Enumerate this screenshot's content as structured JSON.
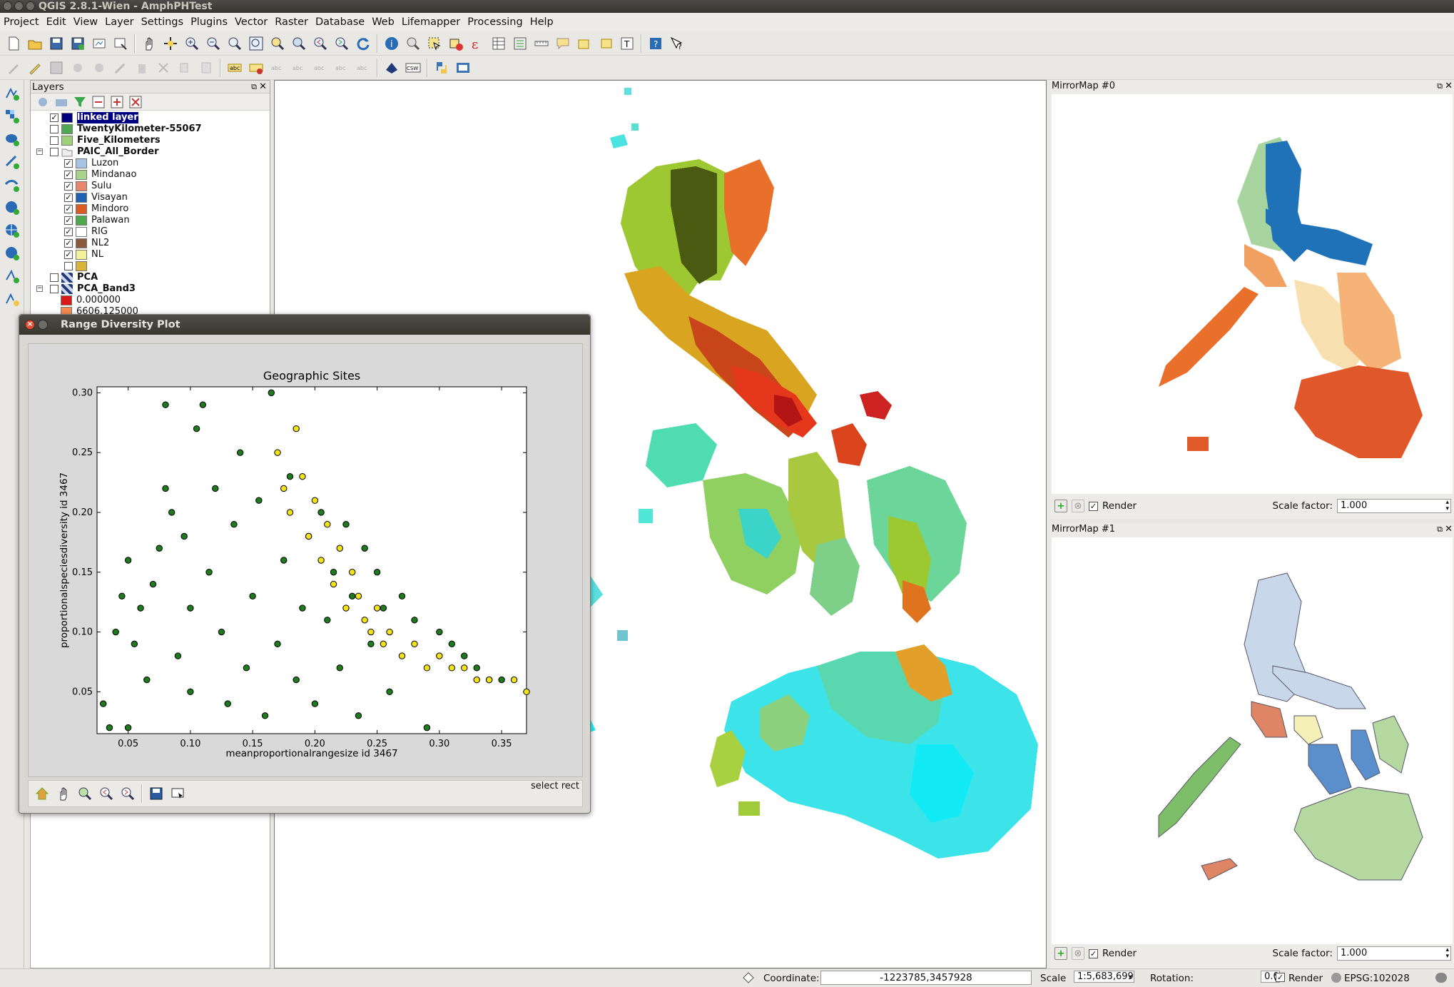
{
  "window": {
    "title": "QGIS 2.8.1-Wien - AmphPHTest"
  },
  "menu": [
    "Project",
    "Edit",
    "View",
    "Layer",
    "Settings",
    "Plugins",
    "Vector",
    "Raster",
    "Database",
    "Web",
    "Lifemapper",
    "Processing",
    "Help"
  ],
  "layers_panel": {
    "title": "Layers",
    "items": [
      {
        "label": "linked layer",
        "checked": true,
        "bold": true,
        "selected": true,
        "swatch": "#000080"
      },
      {
        "label": "TwentyKilometer-55067",
        "checked": false,
        "bold": true,
        "swatch": "#52a852"
      },
      {
        "label": "Five_Kilometers",
        "checked": false,
        "bold": true,
        "swatch": "#9fd07a"
      },
      {
        "label": "PAIC_All_Border",
        "checked": false,
        "bold": true,
        "group": true
      },
      {
        "label": "Luzon",
        "checked": true,
        "swatch": "#a6c4e4"
      },
      {
        "label": "Mindanao",
        "checked": true,
        "swatch": "#a7d38a"
      },
      {
        "label": "Sulu",
        "checked": true,
        "swatch": "#e8866a"
      },
      {
        "label": "Visayan",
        "checked": true,
        "swatch": "#1f62b4"
      },
      {
        "label": "Mindoro",
        "checked": true,
        "swatch": "#dd5a23"
      },
      {
        "label": "Palawan",
        "checked": true,
        "swatch": "#4fa84d"
      },
      {
        "label": "RIG",
        "checked": true,
        "swatch": "#ffffff"
      },
      {
        "label": "NL2",
        "checked": true,
        "swatch": "#8b5a3a"
      },
      {
        "label": "NL",
        "checked": true,
        "swatch": "#f4f19a"
      },
      {
        "label": "",
        "checked": false,
        "swatch": "#d9b43a"
      },
      {
        "label": "PCA",
        "checked": false,
        "bold": true,
        "raster": true
      },
      {
        "label": "PCA_Band3",
        "checked": false,
        "bold": true,
        "raster": true,
        "group": true
      },
      {
        "label": "0.000000",
        "swatch": "#d7191c"
      },
      {
        "label": "6606.125000",
        "swatch": "#f58d52"
      }
    ]
  },
  "dialog": {
    "title": "Range Diversity Plot",
    "status": "select rect"
  },
  "chart_data": {
    "type": "scatter",
    "title": "Geographic Sites",
    "xlabel": "meanproportionalrangesize id 3467",
    "ylabel": "proportionalspeciesdiversity id 3467",
    "xlim": [
      0.025,
      0.37
    ],
    "ylim": [
      0.015,
      0.305
    ],
    "xticks": [
      "0.05",
      "0.10",
      "0.15",
      "0.20",
      "0.25",
      "0.30",
      "0.35"
    ],
    "yticks": [
      "0.05",
      "0.10",
      "0.15",
      "0.20",
      "0.25",
      "0.30"
    ],
    "grid": false,
    "series": [
      {
        "color": "#1d7a1d",
        "values": [
          [
            0.03,
            0.04
          ],
          [
            0.035,
            0.02
          ],
          [
            0.05,
            0.02
          ],
          [
            0.04,
            0.1
          ],
          [
            0.045,
            0.13
          ],
          [
            0.05,
            0.16
          ],
          [
            0.055,
            0.09
          ],
          [
            0.06,
            0.12
          ],
          [
            0.065,
            0.06
          ],
          [
            0.07,
            0.14
          ],
          [
            0.075,
            0.17
          ],
          [
            0.08,
            0.29
          ],
          [
            0.08,
            0.22
          ],
          [
            0.085,
            0.2
          ],
          [
            0.09,
            0.08
          ],
          [
            0.095,
            0.18
          ],
          [
            0.1,
            0.12
          ],
          [
            0.1,
            0.05
          ],
          [
            0.105,
            0.27
          ],
          [
            0.11,
            0.29
          ],
          [
            0.115,
            0.15
          ],
          [
            0.12,
            0.22
          ],
          [
            0.125,
            0.1
          ],
          [
            0.13,
            0.04
          ],
          [
            0.135,
            0.19
          ],
          [
            0.14,
            0.25
          ],
          [
            0.145,
            0.07
          ],
          [
            0.15,
            0.13
          ],
          [
            0.155,
            0.21
          ],
          [
            0.16,
            0.03
          ],
          [
            0.165,
            0.3
          ],
          [
            0.17,
            0.09
          ],
          [
            0.175,
            0.16
          ],
          [
            0.18,
            0.23
          ],
          [
            0.185,
            0.06
          ],
          [
            0.19,
            0.12
          ],
          [
            0.195,
            0.18
          ],
          [
            0.2,
            0.04
          ],
          [
            0.205,
            0.2
          ],
          [
            0.21,
            0.11
          ],
          [
            0.215,
            0.15
          ],
          [
            0.22,
            0.07
          ],
          [
            0.225,
            0.19
          ],
          [
            0.23,
            0.13
          ],
          [
            0.235,
            0.03
          ],
          [
            0.24,
            0.17
          ],
          [
            0.245,
            0.09
          ],
          [
            0.25,
            0.15
          ],
          [
            0.255,
            0.12
          ],
          [
            0.26,
            0.05
          ],
          [
            0.27,
            0.13
          ],
          [
            0.28,
            0.11
          ],
          [
            0.29,
            0.02
          ],
          [
            0.3,
            0.1
          ],
          [
            0.31,
            0.09
          ],
          [
            0.32,
            0.08
          ],
          [
            0.33,
            0.07
          ],
          [
            0.34,
            0.06
          ],
          [
            0.35,
            0.06
          ]
        ]
      },
      {
        "color": "#f2e21a",
        "values": [
          [
            0.17,
            0.25
          ],
          [
            0.175,
            0.22
          ],
          [
            0.18,
            0.2
          ],
          [
            0.185,
            0.27
          ],
          [
            0.19,
            0.23
          ],
          [
            0.195,
            0.18
          ],
          [
            0.2,
            0.21
          ],
          [
            0.205,
            0.16
          ],
          [
            0.21,
            0.19
          ],
          [
            0.215,
            0.14
          ],
          [
            0.22,
            0.17
          ],
          [
            0.225,
            0.12
          ],
          [
            0.23,
            0.15
          ],
          [
            0.235,
            0.13
          ],
          [
            0.24,
            0.11
          ],
          [
            0.245,
            0.1
          ],
          [
            0.25,
            0.12
          ],
          [
            0.255,
            0.09
          ],
          [
            0.26,
            0.1
          ],
          [
            0.27,
            0.08
          ],
          [
            0.28,
            0.09
          ],
          [
            0.29,
            0.07
          ],
          [
            0.3,
            0.08
          ],
          [
            0.31,
            0.07
          ],
          [
            0.32,
            0.07
          ],
          [
            0.33,
            0.06
          ],
          [
            0.34,
            0.06
          ],
          [
            0.36,
            0.06
          ],
          [
            0.37,
            0.05
          ]
        ]
      }
    ]
  },
  "mirror0": {
    "title": "MirrorMap #0",
    "render_label": "Render",
    "scale_label": "Scale factor:",
    "scale_value": "1.000"
  },
  "mirror1": {
    "title": "MirrorMap #1",
    "render_label": "Render",
    "scale_label": "Scale factor:",
    "scale_value": "1.000"
  },
  "status": {
    "coord_label": "Coordinate:",
    "coord_value": "-1223785,3457928",
    "scale_label": "Scale",
    "scale_value": "1:5,683,699",
    "rotation_label": "Rotation:",
    "rotation_value": "0.0",
    "render_label": "Render",
    "crs": "EPSG:102028"
  }
}
